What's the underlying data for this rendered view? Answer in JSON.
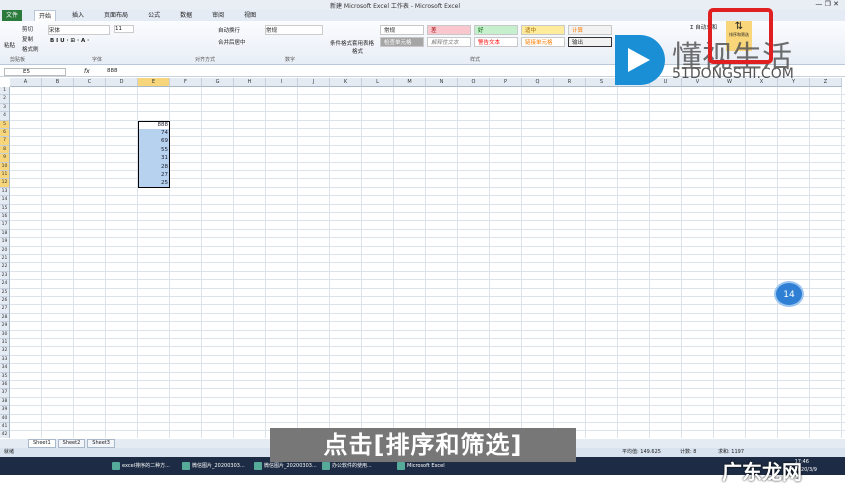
{
  "window": {
    "title": "新建 Microsoft Excel 工作表 - Microsoft Excel"
  },
  "tabs": [
    "文件",
    "开始",
    "插入",
    "页面布局",
    "公式",
    "数据",
    "审阅",
    "视图"
  ],
  "ribbon": {
    "clipboard": {
      "paste": "粘贴",
      "cut": "剪切",
      "copy": "复制",
      "format_painter": "格式刷",
      "group": "剪贴板"
    },
    "font": {
      "name": "宋体",
      "size": "11",
      "group": "字体"
    },
    "alignment": {
      "wrap": "自动换行",
      "merge": "合并后居中",
      "group": "对齐方式"
    },
    "number": {
      "format": "常规",
      "group": "数字"
    },
    "styles": {
      "conditional": "条件格式",
      "table": "套用表格格式",
      "group": "样式",
      "cells": [
        [
          "常规",
          "差",
          "好",
          "适中",
          "计算"
        ],
        [
          "检查单元格",
          "解释性文本",
          "警告文本",
          "链接单元格",
          "输出"
        ]
      ]
    },
    "editing": {
      "sum": "Σ 自动求和",
      "sort_filter": "排序和筛选"
    }
  },
  "formula_bar": {
    "name_box": "E5",
    "fx": "fx",
    "value": "888"
  },
  "grid": {
    "columns": [
      "A",
      "B",
      "C",
      "D",
      "E",
      "F",
      "G",
      "H",
      "I",
      "J",
      "K",
      "L",
      "M",
      "N",
      "O",
      "P",
      "Q",
      "R",
      "S",
      "T",
      "U",
      "V",
      "W",
      "X",
      "Y",
      "Z"
    ],
    "row_count": 42,
    "selected_column": "E",
    "selected_rows": [
      5,
      12
    ],
    "cells": [
      {
        "col": "E",
        "row": 5,
        "value": "888"
      },
      {
        "col": "E",
        "row": 6,
        "value": "74"
      },
      {
        "col": "E",
        "row": 7,
        "value": "69"
      },
      {
        "col": "E",
        "row": 8,
        "value": "55"
      },
      {
        "col": "E",
        "row": 9,
        "value": "31"
      },
      {
        "col": "E",
        "row": 10,
        "value": "28"
      },
      {
        "col": "E",
        "row": 11,
        "value": "27"
      },
      {
        "col": "E",
        "row": 12,
        "value": "25"
      }
    ]
  },
  "sheets": [
    "Sheet1",
    "Sheet2",
    "Sheet3"
  ],
  "status": {
    "ready": "就绪",
    "average": "平均值: 149.625",
    "count": "计数: 8",
    "sum": "求和: 1197"
  },
  "taskbar": [
    "excel排序的二种方...",
    "微信图片_20200303...",
    "微信图片_20200303...",
    "办公软件的使用...",
    "Microsoft Excel"
  ],
  "clock": {
    "time": "17:46",
    "date": "2020/3/9"
  },
  "overlay": {
    "subtitle": "点击[排序和筛选]",
    "badge": "14",
    "watermark_logo": "懂视生活 51DONGSHI.COM",
    "watermark_corner": "广东龙网"
  },
  "colors": {
    "file_tab": "#2a7a3b",
    "selection": "#b6d2ef",
    "highlight": "#e02020",
    "header_selected": "#f7d57a"
  }
}
